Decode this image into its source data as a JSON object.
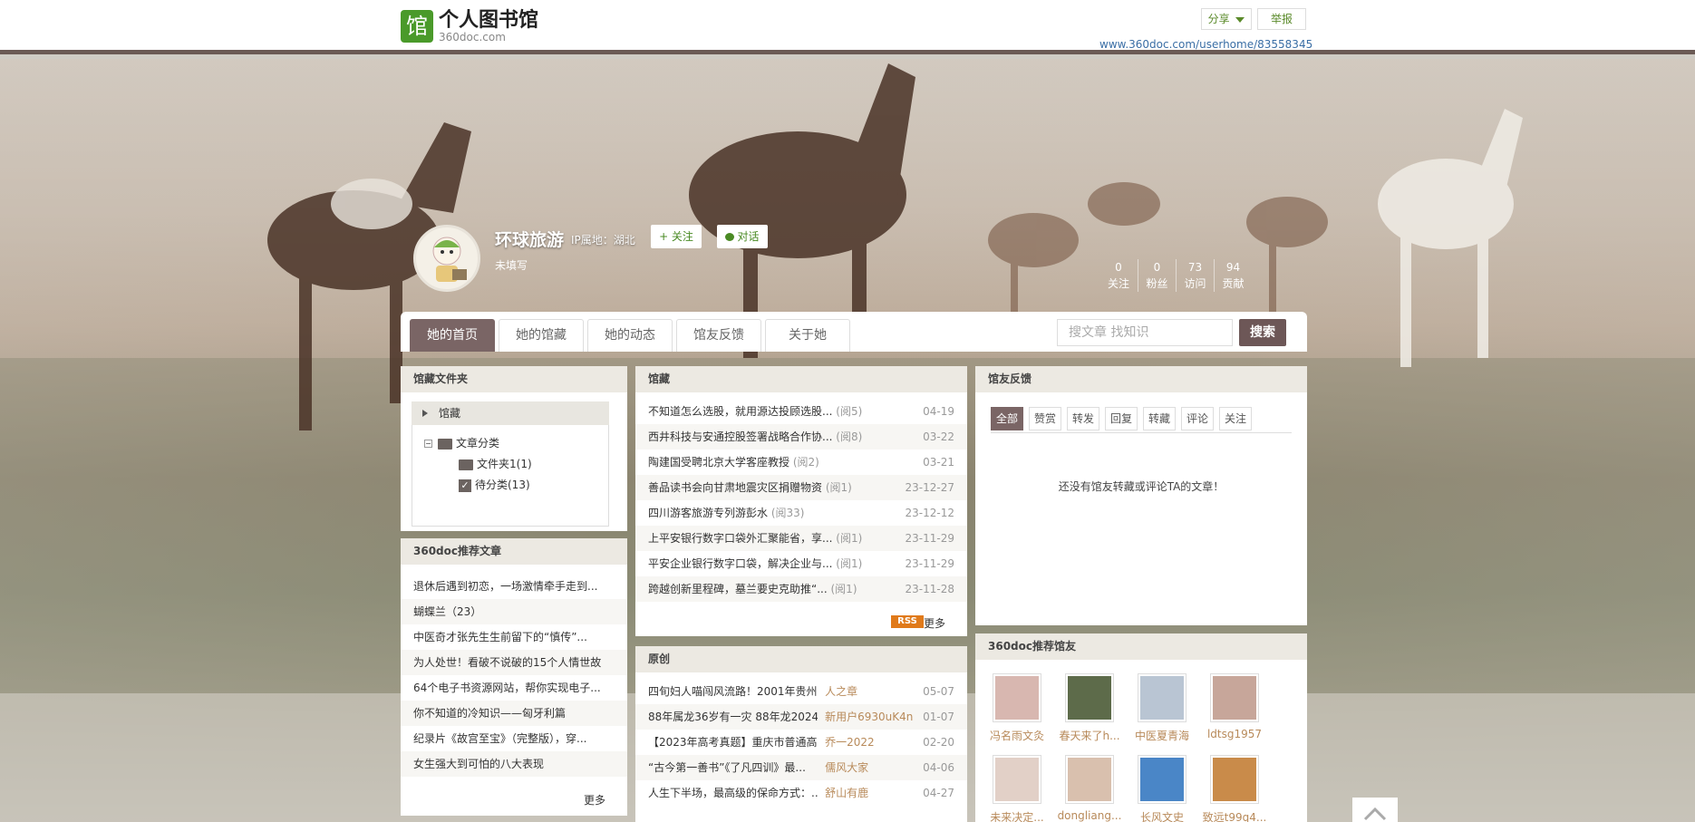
{
  "header": {
    "logo_glyph": "馆",
    "title": "个人图书馆",
    "subtitle": "360doc.com",
    "share_label": "分享",
    "report_label": "举报",
    "url": "www.360doc.com/userhome/83558345"
  },
  "profile": {
    "name": "环球旅游",
    "ip_location": "IP属地：湖北",
    "follow_label": "+ 关注",
    "chat_label": "对话",
    "signature": "未填写",
    "stats": [
      {
        "value": "0",
        "label": "关注"
      },
      {
        "value": "0",
        "label": "粉丝"
      },
      {
        "value": "73",
        "label": "访问"
      },
      {
        "value": "94",
        "label": "贡献"
      }
    ]
  },
  "nav": {
    "tabs": [
      "她的首页",
      "她的馆藏",
      "她的动态",
      "馆友反馈",
      "关于她"
    ],
    "active_tab": "她的首页",
    "search_placeholder": "搜文章 找知识",
    "search_button": "搜索"
  },
  "folder_panel": {
    "title": "馆藏文件夹",
    "root": "馆藏",
    "category": "文章分类",
    "children": [
      "文件夹1(1)",
      "待分类(13)"
    ]
  },
  "recommend_panel": {
    "title": "360doc推荐文章",
    "items": [
      "退休后遇到初恋，一场激情牵手走到...",
      "蝴蝶兰（23）",
      "中医奇才张先生生前留下的“慎传”...",
      "为人处世！看破不说破的15个人情世故",
      "64个电子书资源网站，帮你实现电子...",
      "你不知道的冷知识——匈牙利篇",
      "纪录片《故宫至宝》（完整版），穿...",
      "女生强大到可怕的八大表现"
    ],
    "more": "更多"
  },
  "collection_panel": {
    "title": "馆藏",
    "items": [
      {
        "title": "不知道怎么选股，就用源达投顾选股...",
        "reads": "(阅5)",
        "date": "04-19"
      },
      {
        "title": "西井科技与安通控股签署战略合作协...",
        "reads": "(阅8)",
        "date": "03-22"
      },
      {
        "title": "陶建国受聘北京大学客座教授",
        "reads": "(阅2)",
        "date": "03-21"
      },
      {
        "title": "善品读书会向甘肃地震灾区捐赠物资",
        "reads": "(阅1)",
        "date": "23-12-27"
      },
      {
        "title": "四川游客旅游专列游彭水",
        "reads": "(阅33)",
        "date": "23-12-12"
      },
      {
        "title": "上平安银行数字口袋外汇聚能省，享...",
        "reads": "(阅1)",
        "date": "23-11-29"
      },
      {
        "title": "平安企业银行数字口袋，解决企业与...",
        "reads": "(阅1)",
        "date": "23-11-29"
      },
      {
        "title": "跨越创新里程碑，墓兰要史克助推“...",
        "reads": "(阅1)",
        "date": "23-11-28"
      }
    ],
    "rss": "RSS",
    "more": "更多"
  },
  "original_panel": {
    "title": "原创",
    "items": [
      {
        "title": "四旬妇人喵闯风流路！2001年贵州...",
        "author": "人之章",
        "date": "05-07"
      },
      {
        "title": "88年属龙36岁有一灾 88年龙2024...",
        "author": "新用户6930uK4n",
        "date": "01-07"
      },
      {
        "title": "【2023年高考真题】重庆市普通高...",
        "author": "乔一2022",
        "date": "02-20"
      },
      {
        "title": "“古今第一善书”《了凡四训》最...",
        "author": "儒风大家",
        "date": "04-06"
      },
      {
        "title": "人生下半场，最高级的保命方式：...",
        "author": "舒山有鹿",
        "date": "04-27"
      }
    ]
  },
  "feedback_panel": {
    "title": "馆友反馈",
    "filters": [
      "全部",
      "赞赏",
      "转发",
      "回复",
      "转藏",
      "评论",
      "关注"
    ],
    "active_filter": "全部",
    "empty_text": "还没有馆友转藏或评论TA的文章！"
  },
  "friends_panel": {
    "title": "360doc推荐馆友",
    "friends": [
      {
        "name": "冯名雨文灸"
      },
      {
        "name": "春天来了h..."
      },
      {
        "name": "中医夏青海"
      },
      {
        "name": "ldtsg1957"
      },
      {
        "name": "未来决定..."
      },
      {
        "name": "dongliang..."
      },
      {
        "name": "长风文史"
      },
      {
        "name": "致远t99q4..."
      }
    ]
  },
  "colors": {
    "accent": "#7a6565",
    "green": "#4a9a2a",
    "link": "#3a6ea5",
    "author": "#b88a5a"
  }
}
